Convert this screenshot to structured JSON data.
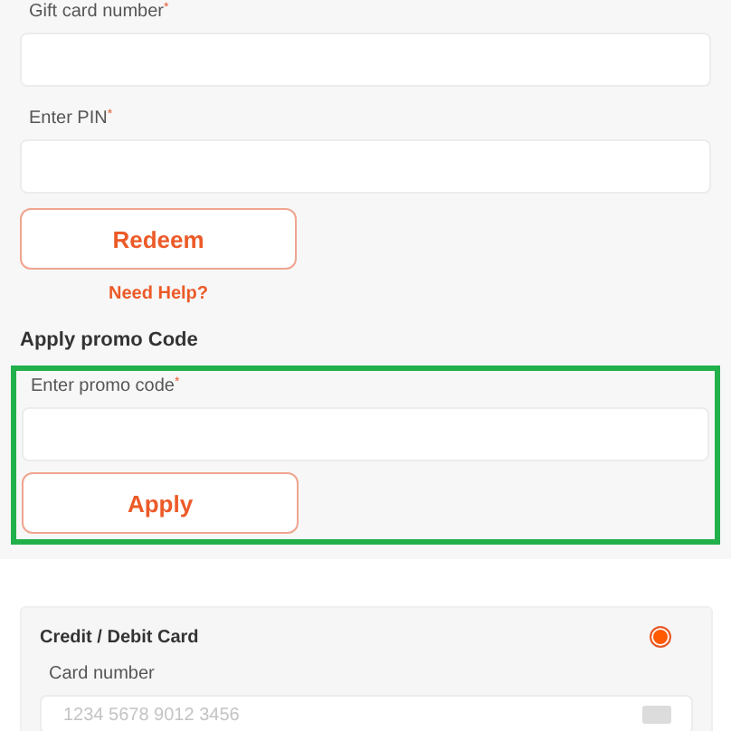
{
  "gift_card": {
    "fields": [
      {
        "label": "Gift card number$^{*}$"
      },
      {
        "label": "Enter PIN$^{*}$"
      }
    ],
    "redeem_button": "Redeem",
    "help_link": "Need Help?"
  },
  "promo": {
    "heading": "Apply promo Code",
    "highlighted": true,
    "field": {
      "label": "Enter promo code$^{*}$"
    },
    "apply_button": "Apply"
  },
  "payment_methods": [
    {
      "title": "Credit / Debit Card",
      "selected": true,
      "field": {
        "label": "Card number",
        "placeholder": "1234 5678 9012 3456"
      }
    }
  ]
}
